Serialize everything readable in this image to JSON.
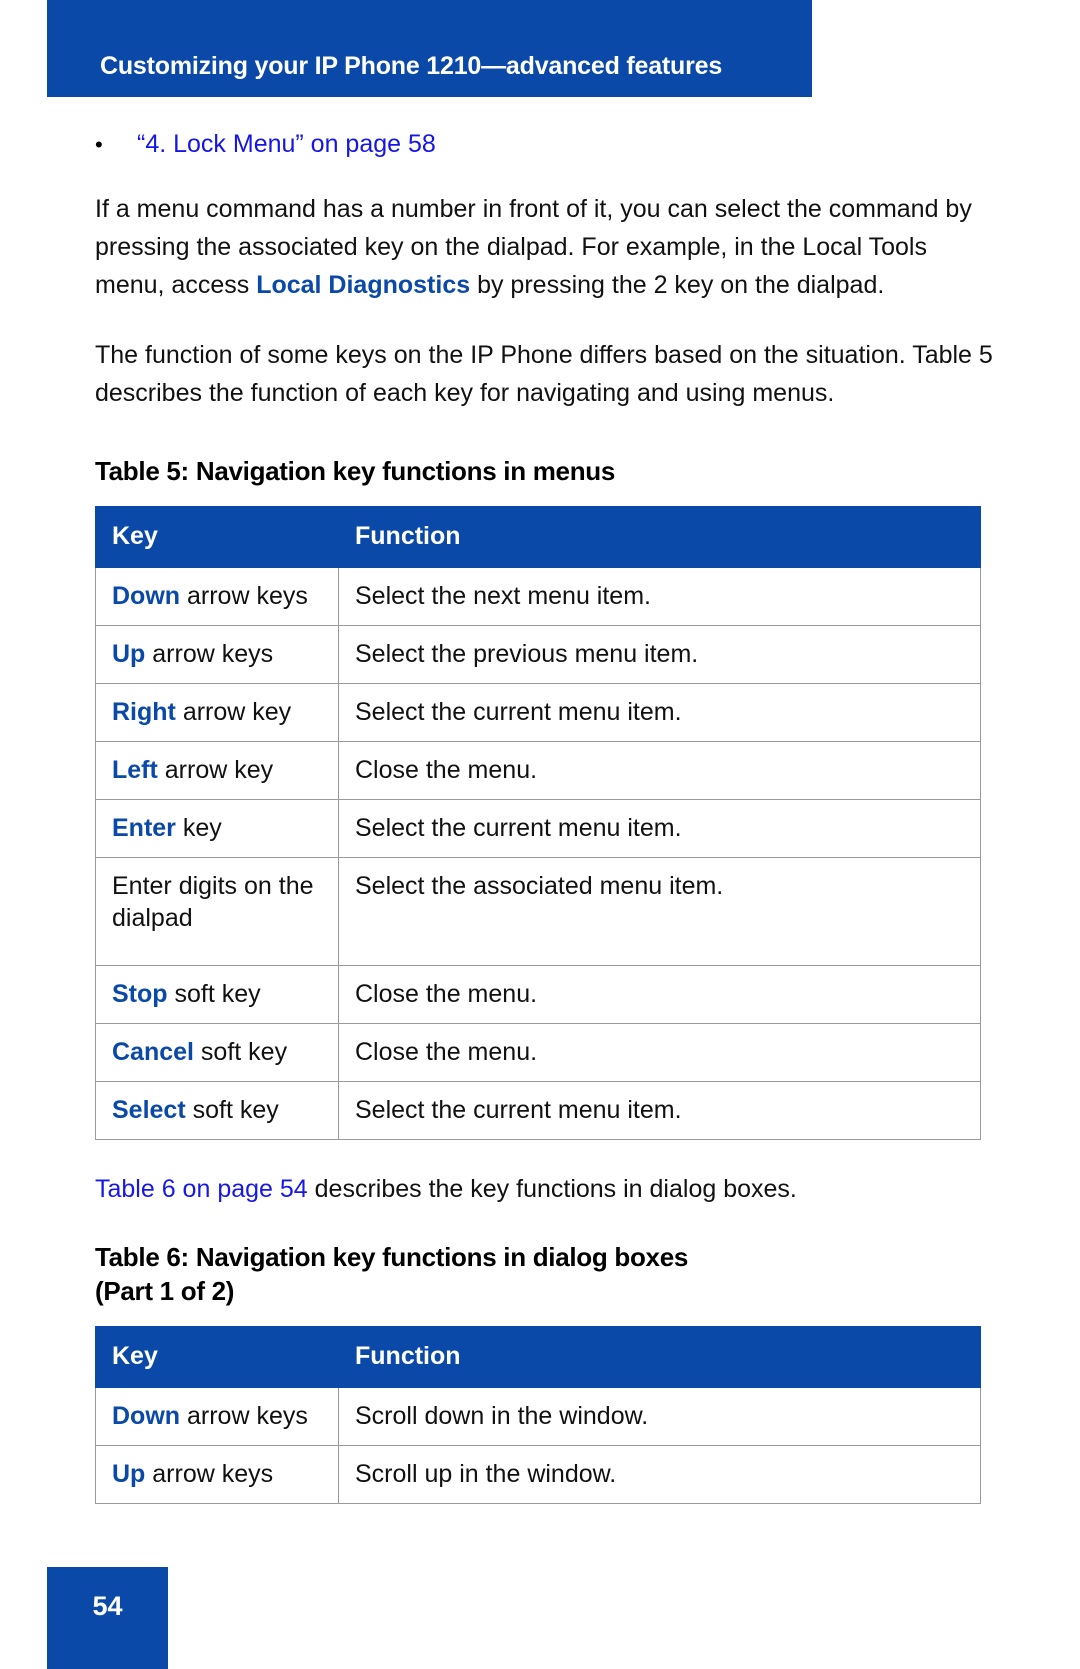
{
  "header": {
    "title": "Customizing your IP Phone 1210—advanced features"
  },
  "bullets": [
    {
      "marker": "•",
      "text": "“4. Lock Menu” on page 58"
    }
  ],
  "paragraphs": {
    "p1_a": "If a menu command has a number in front of it, you can select the command by pressing the associated key on the dialpad. For example, in the Local Tools menu, access ",
    "p1_emphasis": "Local Diagnostics",
    "p1_b": " by pressing the 2 key on the dialpad.",
    "p2": "The function of some keys on the IP Phone differs based on the situation. Table 5 describes the function of each key for navigating and using menus.",
    "p3_link": "Table 6 on page 54",
    "p3_rest": " describes the key functions in dialog boxes."
  },
  "table5": {
    "caption": "Table 5: Navigation key functions in menus",
    "columns": [
      "Key",
      "Function"
    ],
    "rows": [
      {
        "key_kw": "Down",
        "key_rest": " arrow keys",
        "function": "Select the next menu item."
      },
      {
        "key_kw": "Up",
        "key_rest": " arrow keys",
        "function": "Select the previous menu item."
      },
      {
        "key_kw": "Right",
        "key_rest": " arrow key",
        "function": "Select the current menu item."
      },
      {
        "key_kw": "Left",
        "key_rest": " arrow key",
        "function": "Close the menu."
      },
      {
        "key_kw": "Enter",
        "key_rest": " key",
        "function": "Select the current menu item."
      },
      {
        "key_kw": "",
        "key_rest": "Enter digits on the dialpad",
        "function": "Select the associated menu item."
      },
      {
        "key_kw": "Stop",
        "key_rest": " soft key",
        "function": "Close the menu."
      },
      {
        "key_kw": "Cancel",
        "key_rest": " soft key",
        "function": "Close the menu."
      },
      {
        "key_kw": "Select",
        "key_rest": " soft key",
        "function": "Select the current menu item."
      }
    ]
  },
  "table6": {
    "caption_line1": "Table 6: Navigation key functions in dialog boxes",
    "caption_line2": "(Part 1 of 2)",
    "columns": [
      "Key",
      "Function"
    ],
    "rows": [
      {
        "key_kw": "Down",
        "key_rest": " arrow keys",
        "function": "Scroll down in the window."
      },
      {
        "key_kw": "Up",
        "key_rest": " arrow keys",
        "function": "Scroll up in the window."
      }
    ]
  },
  "footer": {
    "page_number": "54"
  },
  "colors": {
    "brand_blue": "#0B49A8",
    "link_blue": "#1415E6",
    "rule_gray": "#9a9a9a"
  }
}
